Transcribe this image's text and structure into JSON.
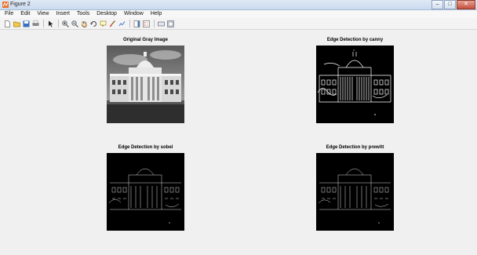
{
  "window": {
    "title": "Figure 2",
    "controls": {
      "minimize": "–",
      "maximize": "□",
      "close": "✕"
    }
  },
  "menubar": {
    "items": [
      {
        "id": "file",
        "label": "File"
      },
      {
        "id": "edit",
        "label": "Edit"
      },
      {
        "id": "view",
        "label": "View"
      },
      {
        "id": "insert",
        "label": "Insert"
      },
      {
        "id": "tools",
        "label": "Tools"
      },
      {
        "id": "desktop",
        "label": "Desktop"
      },
      {
        "id": "window",
        "label": "Window"
      },
      {
        "id": "help",
        "label": "Help"
      }
    ]
  },
  "toolbar": {
    "buttons": [
      "new-figure-icon",
      "open-file-icon",
      "save-icon",
      "print-icon",
      "edit-plot-arrow-icon",
      "zoom-in-icon",
      "zoom-out-icon",
      "pan-hand-icon",
      "rotate-3d-icon",
      "data-cursor-icon",
      "brush-icon",
      "link-plot-icon",
      "colorbar-icon",
      "legend-icon",
      "hide-plot-tools-icon",
      "show-plot-tools-icon"
    ]
  },
  "figure": {
    "panels": [
      {
        "id": "original",
        "title": "Original Gray Image",
        "kind": "photo"
      },
      {
        "id": "canny",
        "title": "Edge Detection by canny",
        "kind": "edges"
      },
      {
        "id": "sobel",
        "title": "Edge Detection by sobel",
        "kind": "edges"
      },
      {
        "id": "prewitt",
        "title": "Edge Detection by prewitt",
        "kind": "edges"
      }
    ]
  },
  "colors": {
    "edge_background": "#000000",
    "edge_lines": "#ffffff",
    "sky": "#8a8a8a",
    "building": "#d8d8d8",
    "ground": "#2e2e2e"
  }
}
